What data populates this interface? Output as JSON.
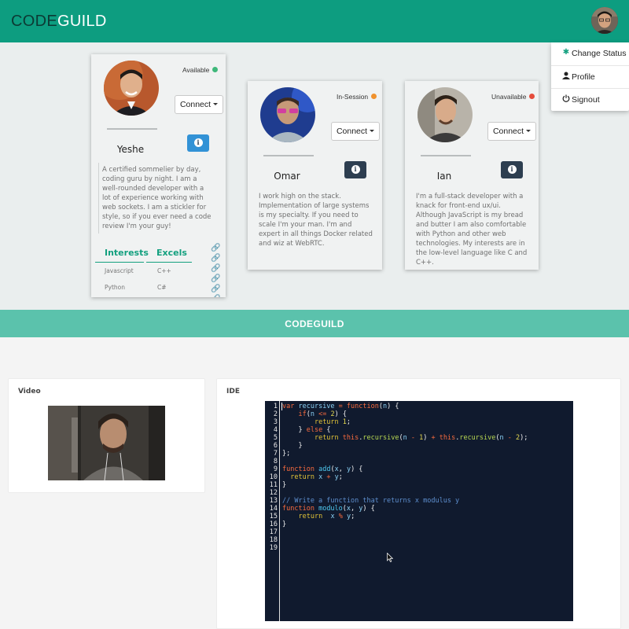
{
  "nav": {
    "brand_prefix": "CODE",
    "brand_suffix": "GUILD"
  },
  "dropdown": {
    "items": [
      {
        "label": "Change Status",
        "icon": "asterisk-icon",
        "icon_color": "#13a07f"
      },
      {
        "label": "Profile",
        "icon": "user-icon"
      },
      {
        "label": "Signout",
        "icon": "power-icon"
      }
    ]
  },
  "cards": [
    {
      "name": "Yeshe",
      "status": "Available",
      "status_color": "#3fb87a",
      "connect_label": "Connect",
      "info_color": "#3292d6",
      "bio": "A certified sommelier by day, coding guru by night. I am a well-rounded developer with a lot of experience working with web sockets. I am a stickler for style, so if you ever need a code review I'm your guy!",
      "interests_heading": "Interests",
      "excels_heading": "Excels",
      "interests": [
        "Javascript",
        "Python"
      ],
      "excels": [
        "C++",
        "C#"
      ]
    },
    {
      "name": "Omar",
      "status": "In-Session",
      "status_color": "#f0922e",
      "connect_label": "Connect",
      "info_color": "#2d3e50",
      "bio": "I work high on the stack. Implementation of large systems is my specialty. If you need to scale I'm your man. I'm and expert in all things Docker related and wiz at WebRTC."
    },
    {
      "name": "Ian",
      "status": "Unavailable",
      "status_color": "#e54c3c",
      "connect_label": "Connect",
      "info_color": "#2d3e50",
      "bio": "I'm a full-stack developer with a knack for front-end ux/ui. Although JavaScript is my bread and butter I am also comfortable with Python and other web technologies. My interests are in the low-level language like C and C++."
    }
  ],
  "banner": {
    "title": "CODEGUILD"
  },
  "video_panel": {
    "title": "Video"
  },
  "ide_panel": {
    "title": "IDE",
    "line_numbers": [
      "1",
      "2",
      "3",
      "4",
      "5",
      "6",
      "7",
      "8",
      "9",
      "10",
      "11",
      "12",
      "13",
      "14",
      "15",
      "16",
      "17",
      "18",
      "19"
    ]
  }
}
